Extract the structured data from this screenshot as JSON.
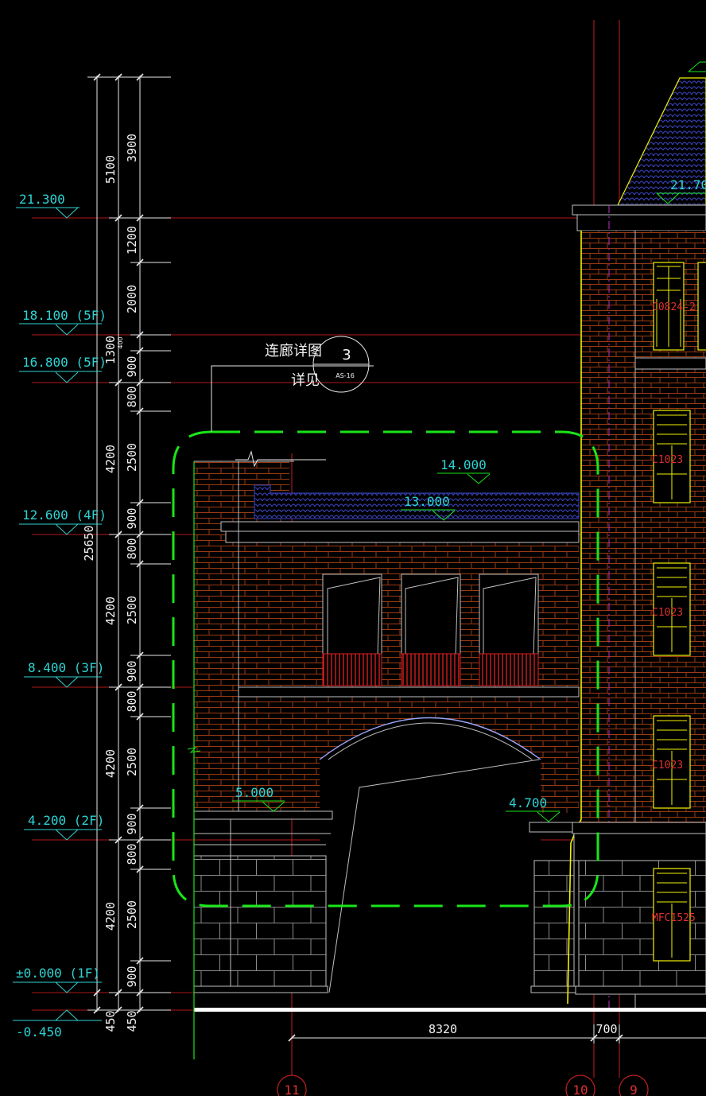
{
  "elevations": [
    {
      "label": "21.300"
    },
    {
      "label": "18.100 (5F)"
    },
    {
      "label": "16.800 (5F)"
    },
    {
      "label": "12.600 (4F)"
    },
    {
      "label": "8.400 (3F)"
    },
    {
      "label": "4.200 (2F)"
    },
    {
      "label": "±0.000 (1F)"
    },
    {
      "label": "-0.450"
    }
  ],
  "spot_levels": {
    "roof_top": "21.70",
    "corridor_parapet": "14.000",
    "corridor_roof": "13.000",
    "corridor_floor": "5.000",
    "passage_top": "4.700"
  },
  "dims_outer": {
    "total": "25650",
    "top": "5100"
  },
  "dims_mid": [
    "4200",
    "4200",
    "4200",
    "4200",
    "450"
  ],
  "dims_inner": [
    "3900",
    "1200",
    "2000",
    "1300",
    "900",
    "800",
    "2500",
    "900",
    "800",
    "2500",
    "900",
    "800",
    "2500",
    "900",
    "800",
    "2500",
    "900",
    "450"
  ],
  "dims_small": "400",
  "detail": {
    "title": "连廊详图",
    "see": "详见",
    "number": "3",
    "sheet": "AS-16"
  },
  "bottom_dims": {
    "span": "8320",
    "small": "700"
  },
  "grid_axes": [
    "11",
    "10",
    "9"
  ],
  "window_tags": [
    "C0824-2",
    "C1023",
    "C1023",
    "C1023",
    "MFC1525"
  ],
  "colors": {
    "background": "#000000",
    "dim_text": "#2fd3d3",
    "floor_line": "#b01818",
    "cloud_outline": "#19e619",
    "brick": "#9b3a12",
    "roof_tile": "#3c46c8",
    "wall_edge": "#f2f200"
  }
}
